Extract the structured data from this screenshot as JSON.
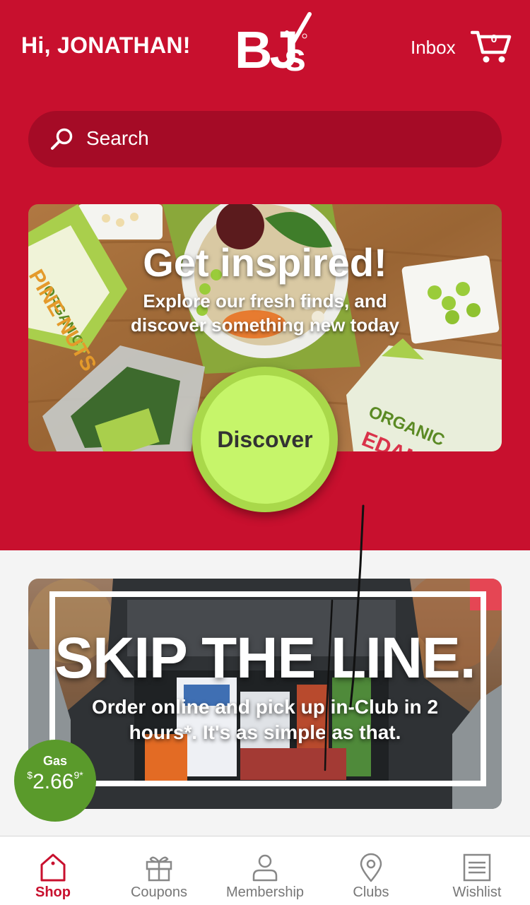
{
  "header": {
    "greeting": "Hi, JONATHAN!",
    "logo_text": "BJ's",
    "inbox_label": "Inbox",
    "cart_count": "0"
  },
  "search": {
    "placeholder": "Search"
  },
  "promo_inspired": {
    "title": "Get inspired!",
    "subtitle": "Explore our fresh finds, and discover something new today",
    "button_label": "Discover",
    "package_text_1": "ORGANIC",
    "package_text_2": "PINE NUTS",
    "package_text_3": "ORGANIC",
    "package_text_4": "EDAMAME"
  },
  "promo_pickup": {
    "title": "SKIP THE LINE.",
    "subtitle": "Order online and pick up in-Club in 2 hours*. It's as simple as that."
  },
  "gas": {
    "label": "Gas",
    "currency": "$",
    "price": "2.66",
    "fraction": "9*"
  },
  "tabs": [
    {
      "label": "Shop",
      "icon": "shop-tag-icon",
      "active": true
    },
    {
      "label": "Coupons",
      "icon": "gift-icon",
      "active": false
    },
    {
      "label": "Membership",
      "icon": "person-icon",
      "active": false
    },
    {
      "label": "Clubs",
      "icon": "location-pin-icon",
      "active": false
    },
    {
      "label": "Wishlist",
      "icon": "list-icon",
      "active": false
    }
  ],
  "colors": {
    "brand_red": "#c8102e",
    "search_bg": "#a50b26",
    "discover_green": "#c6f56a",
    "gas_green": "#5a9a2b",
    "tab_active": "#c8102e",
    "tab_inactive": "#777777"
  }
}
